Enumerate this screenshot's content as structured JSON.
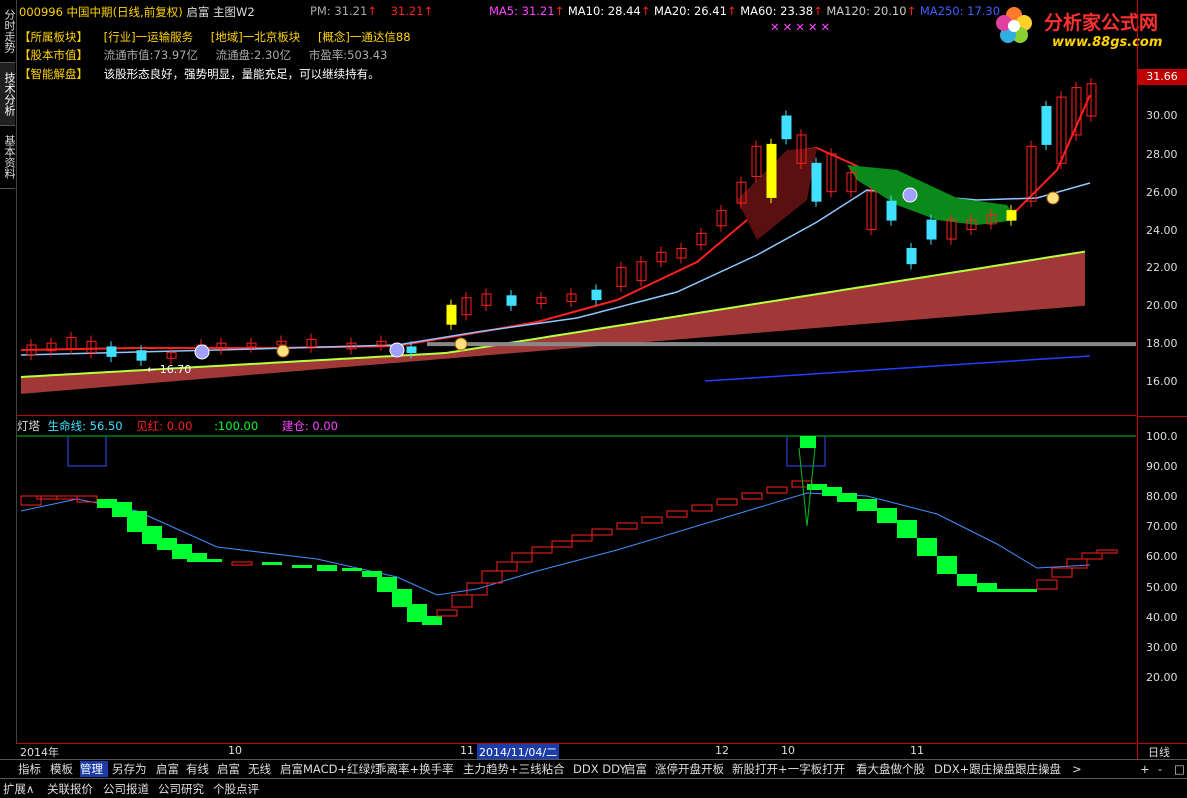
{
  "left_tabs": [
    "分时走势",
    "技术分析",
    "基本资料"
  ],
  "header": {
    "stock": "000996 中国中期",
    "mode": "(日线,前复权)",
    "formula": "启富 主图W2",
    "pm_label": "PM: 31.21",
    "pm_value": "31.21",
    "ma": [
      {
        "label": "MA5: 31.21",
        "color": "#ff44ff"
      },
      {
        "label": "MA10: 28.44",
        "color": "#ffffff"
      },
      {
        "label": "MA20: 26.41",
        "color": "#ffffff"
      },
      {
        "label": "MA60: 23.38",
        "color": "#ffffff"
      },
      {
        "label": "MA120: 20.10",
        "color": "#ffffff"
      },
      {
        "label": "MA250: 17.30",
        "color": "#4060ff"
      }
    ],
    "line2": {
      "k1": "【所属板块】",
      "industry": "[行业]一运输服务",
      "region": "[地域]一北京板块",
      "concept": "[概念]一通达信88"
    },
    "line3": {
      "k1": "【股本市值】",
      "mcap": "流通市值:73.97亿",
      "float": "流通盘:2.30亿",
      "pe": "市盈率:503.43"
    },
    "line4": {
      "k1": "【智能解盘】",
      "text": "该股形态良好，强势明显，量能充足，可以继续持有。"
    }
  },
  "logo": {
    "brand": "分析家公式网",
    "url": "www.88gs.com"
  },
  "current_price_tag": "31.66",
  "price_axis": [
    "30.00",
    "28.00",
    "26.00",
    "24.00",
    "22.00",
    "20.00",
    "18.00",
    "16.00"
  ],
  "low_marker": "← 16.70",
  "indicator": {
    "name": "灯塔",
    "life_label": "生命线: 56.50",
    "jianhong": "见红: 0.00",
    "hundred": ":100.00",
    "jiancang": "建仓: 0.00",
    "axis": [
      "100.0",
      "90.00",
      "80.00",
      "70.00",
      "60.00",
      "50.00",
      "40.00",
      "30.00",
      "20.00"
    ]
  },
  "date_bar": {
    "year": "2014年",
    "m10": "10",
    "m11a": "11",
    "selected": "2014/11/04/二",
    "m12": "12",
    "m10b": "10",
    "m11b": "11",
    "period": "日线"
  },
  "toolbar": {
    "items": [
      "指标",
      "模板",
      "管理",
      "另存为",
      "启富",
      "有线",
      "启富",
      "无线",
      "启富MACD+红绿灯",
      "乖离率+换手率",
      "主力趋势+三线粘合",
      "DDX DDY",
      "启富",
      "涨停开盘开板",
      "新股打开+一字板打开",
      "看大盘做个股",
      "DDX+跟庄操盘",
      "跟庄操盘",
      ">"
    ],
    "right": [
      "+",
      "-",
      "□"
    ]
  },
  "bottom_tabs": [
    "扩展∧",
    "关联报价",
    "公司报道",
    "公司研究",
    "个股点评"
  ],
  "colors": {
    "up": "#ff2020",
    "down": "#40e0ff",
    "grid": "#c00000",
    "green_band": "#00ff30",
    "dark_red": "#6a1010",
    "band_red": "#a03030"
  }
}
